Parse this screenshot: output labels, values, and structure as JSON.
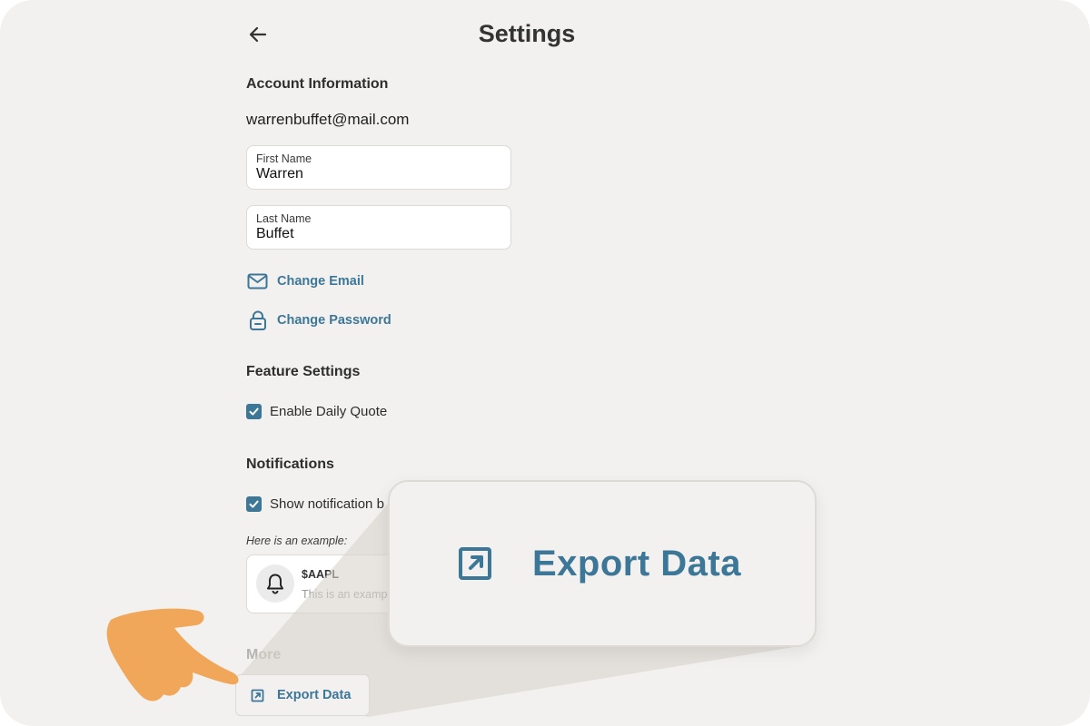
{
  "header": {
    "title": "Settings",
    "back_icon": "arrow-left-icon"
  },
  "account": {
    "heading": "Account Information",
    "email": "warrenbuffet@mail.com",
    "first_name": {
      "label": "First Name",
      "value": "Warren"
    },
    "last_name": {
      "label": "Last Name",
      "value": "Buffet"
    },
    "change_email_label": "Change Email",
    "change_password_label": "Change Password"
  },
  "features": {
    "heading": "Feature Settings",
    "daily_quote": {
      "label": "Enable Daily Quote",
      "checked": true
    }
  },
  "notifications": {
    "heading": "Notifications",
    "show_notification": {
      "label": "Show notification b",
      "checked": true
    },
    "example_caption": "Here is an example:",
    "example": {
      "title": "$AAPL",
      "body": "This is an examp"
    }
  },
  "more": {
    "heading": "More",
    "export_label": "Export Data"
  },
  "zoom": {
    "label": "Export Data"
  },
  "colors": {
    "accent": "#3d7797",
    "background": "#f2f1ef",
    "hand": "#f0a75a"
  }
}
